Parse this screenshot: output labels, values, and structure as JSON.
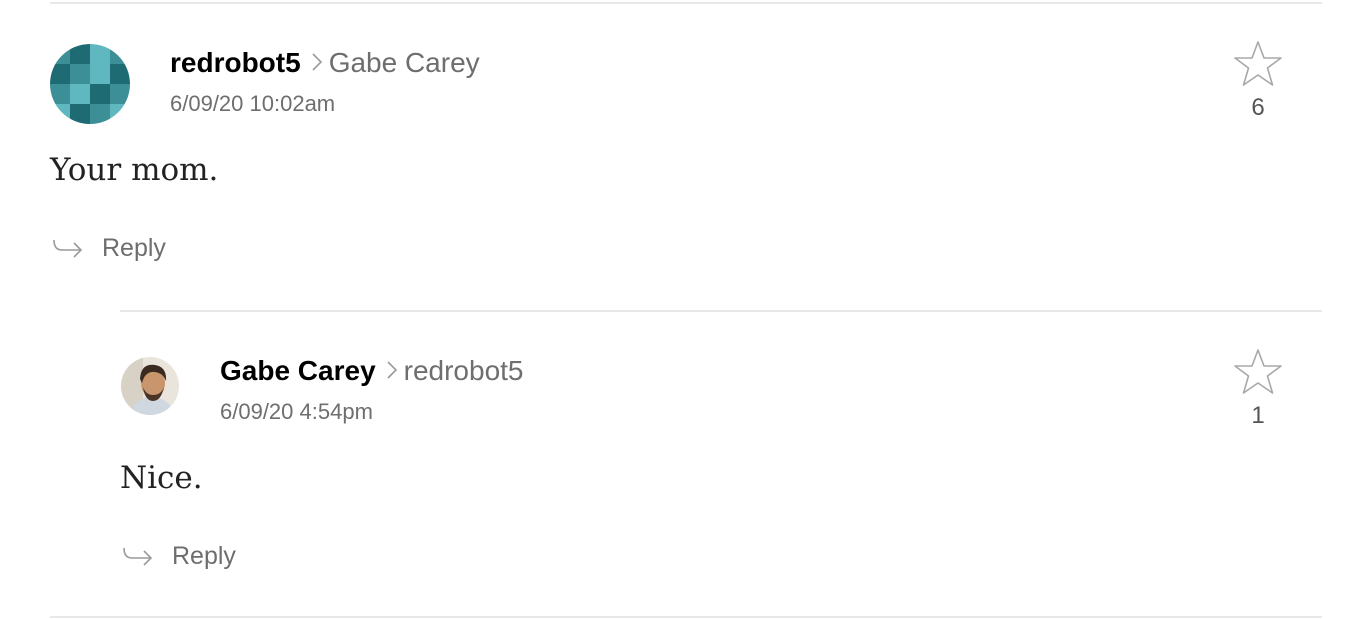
{
  "comments": [
    {
      "author": "redrobot5",
      "reply_to": "Gabe Carey",
      "timestamp": "6/09/20 10:02am",
      "body": "Your mom.",
      "reply_label": "Reply",
      "star_count": "6",
      "avatar_icon": "pixel-identicon-avatar"
    },
    {
      "author": "Gabe Carey",
      "reply_to": "redrobot5",
      "timestamp": "6/09/20 4:54pm",
      "body": "Nice.",
      "reply_label": "Reply",
      "star_count": "1",
      "avatar_icon": "profile-photo-avatar"
    }
  ],
  "colors": {
    "identicon_dark": "#1f6b73",
    "identicon_mid": "#3d8f97",
    "identicon_light": "#5fb7c0",
    "muted_text": "#6e6e6e",
    "divider": "#e8e8e8"
  }
}
